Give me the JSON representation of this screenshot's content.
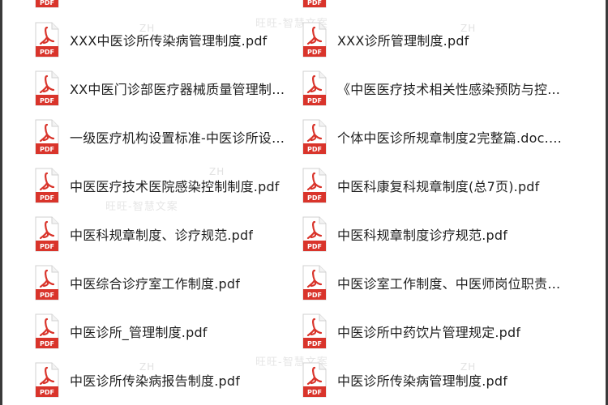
{
  "icon": "pdf-file-icon",
  "icon_label": "PDF",
  "colors": {
    "pdf_red": "#d9342b",
    "paper": "#ffffff",
    "fold": "#f3a29c"
  },
  "watermarks": [
    "ZH",
    "旺旺-智慧文案"
  ],
  "files_left": [
    "XXX中医诊所传染病管理制度.pdf",
    "XX中医门诊部医疗器械质量管理制度....",
    "一级医疗机构设置标准-中医诊所设置...",
    "中医医疗技术医院感染控制制度.pdf",
    "中医科规章制度、诊疗规范.pdf",
    "中医综合诊疗室工作制度.pdf",
    "中医诊所_管理制度.pdf",
    "中医诊所传染病报告制度.pdf"
  ],
  "files_right": [
    "XXX诊所管理制度.pdf",
    "《中医医疗技术相关性感染预防与控...",
    "个体中医诊所规章制度2完整篇.doc.pdf",
    "中医科康复科规章制度(总7页).pdf",
    "中医科规章制度诊疗规范.pdf",
    "中医诊室工作制度、中医师岗位职责.p...",
    "中医诊所中药饮片管理规定.pdf",
    "中医诊所传染病管理制度.pdf"
  ]
}
